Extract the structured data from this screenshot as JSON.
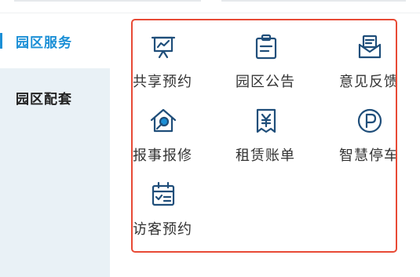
{
  "sidebar": {
    "items": [
      {
        "label": "园区服务",
        "active": true
      },
      {
        "label": "园区配套",
        "active": false
      }
    ]
  },
  "services": [
    {
      "label": "共享预约",
      "icon": "presentation-chart-icon"
    },
    {
      "label": "园区公告",
      "icon": "clipboard-notice-icon"
    },
    {
      "label": "意见反馈",
      "icon": "mail-feedback-icon"
    },
    {
      "label": "报事报修",
      "icon": "house-wrench-icon"
    },
    {
      "label": "租赁账单",
      "icon": "yen-bill-icon"
    },
    {
      "label": "智慧停车",
      "icon": "parking-icon"
    },
    {
      "label": "访客预约",
      "icon": "calendar-check-icon"
    }
  ],
  "colors": {
    "accent": "#1b8fd6",
    "icon": "#1f4e7a",
    "highlight_border": "#e84a35",
    "sidebar_bg": "#e9f1f6"
  }
}
